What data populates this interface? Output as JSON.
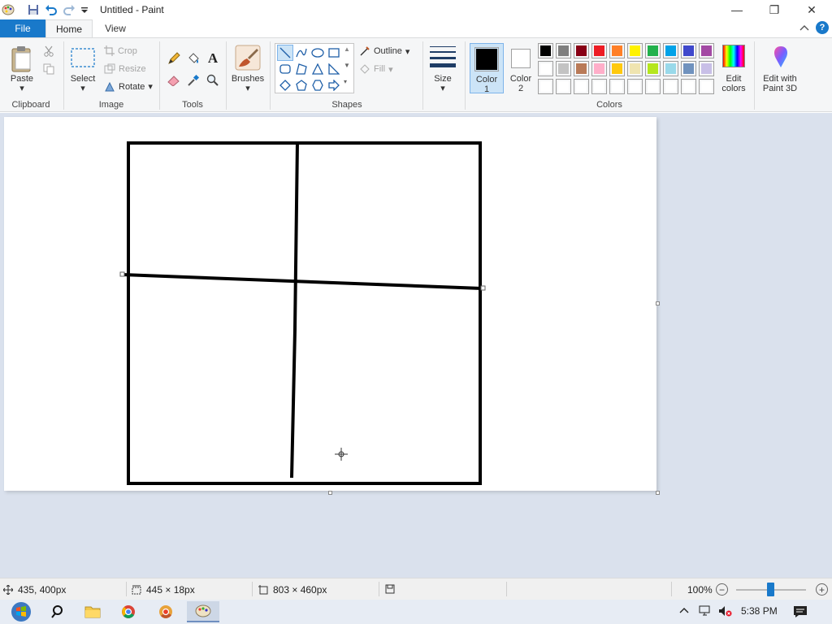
{
  "window": {
    "title": "Untitled - Paint",
    "minimize_glyph": "—",
    "restore_glyph": "❐",
    "close_glyph": "✕"
  },
  "tabs": {
    "file": "File",
    "home": "Home",
    "view": "View"
  },
  "clipboard": {
    "paste": "Paste",
    "group": "Clipboard"
  },
  "image": {
    "select": "Select",
    "crop": "Crop",
    "resize": "Resize",
    "rotate": "Rotate",
    "group": "Image"
  },
  "tools": {
    "group": "Tools"
  },
  "brushes": {
    "label": "Brushes"
  },
  "shapes": {
    "outline": "Outline",
    "fill": "Fill",
    "group": "Shapes"
  },
  "size": {
    "label": "Size"
  },
  "colors": {
    "color1": "Color\n1",
    "color1_line1": "Color",
    "color1_line2": "1",
    "color2_line1": "Color",
    "color2_line2": "2",
    "edit_colors_line1": "Edit",
    "edit_colors_line2": "colors",
    "paint3d_line1": "Edit with",
    "paint3d_line2": "Paint 3D",
    "group": "Colors",
    "color1_value": "#000000",
    "color2_value": "#ffffff",
    "palette_row1": [
      "#000000",
      "#7f7f7f",
      "#880015",
      "#ed1c24",
      "#ff7f27",
      "#fff200",
      "#22b14c",
      "#00a2e8",
      "#3f48cc",
      "#a349a4"
    ],
    "palette_row2": [
      "#ffffff",
      "#c3c3c3",
      "#b97a57",
      "#ffaec9",
      "#ffc90e",
      "#efe4b0",
      "#b5e61d",
      "#99d9ea",
      "#7092be",
      "#c8bfe7"
    ],
    "palette_row3": [
      "#ffffff",
      "#ffffff",
      "#ffffff",
      "#ffffff",
      "#ffffff",
      "#ffffff",
      "#ffffff",
      "#ffffff",
      "#ffffff",
      "#ffffff"
    ]
  },
  "status": {
    "cursor_pos": "435, 400px",
    "selection_size": "445 × 18px",
    "canvas_size": "803 × 460px",
    "zoom": "100%",
    "zoom_fraction": 0.5
  },
  "taskbar": {
    "time": "5:38 PM"
  }
}
